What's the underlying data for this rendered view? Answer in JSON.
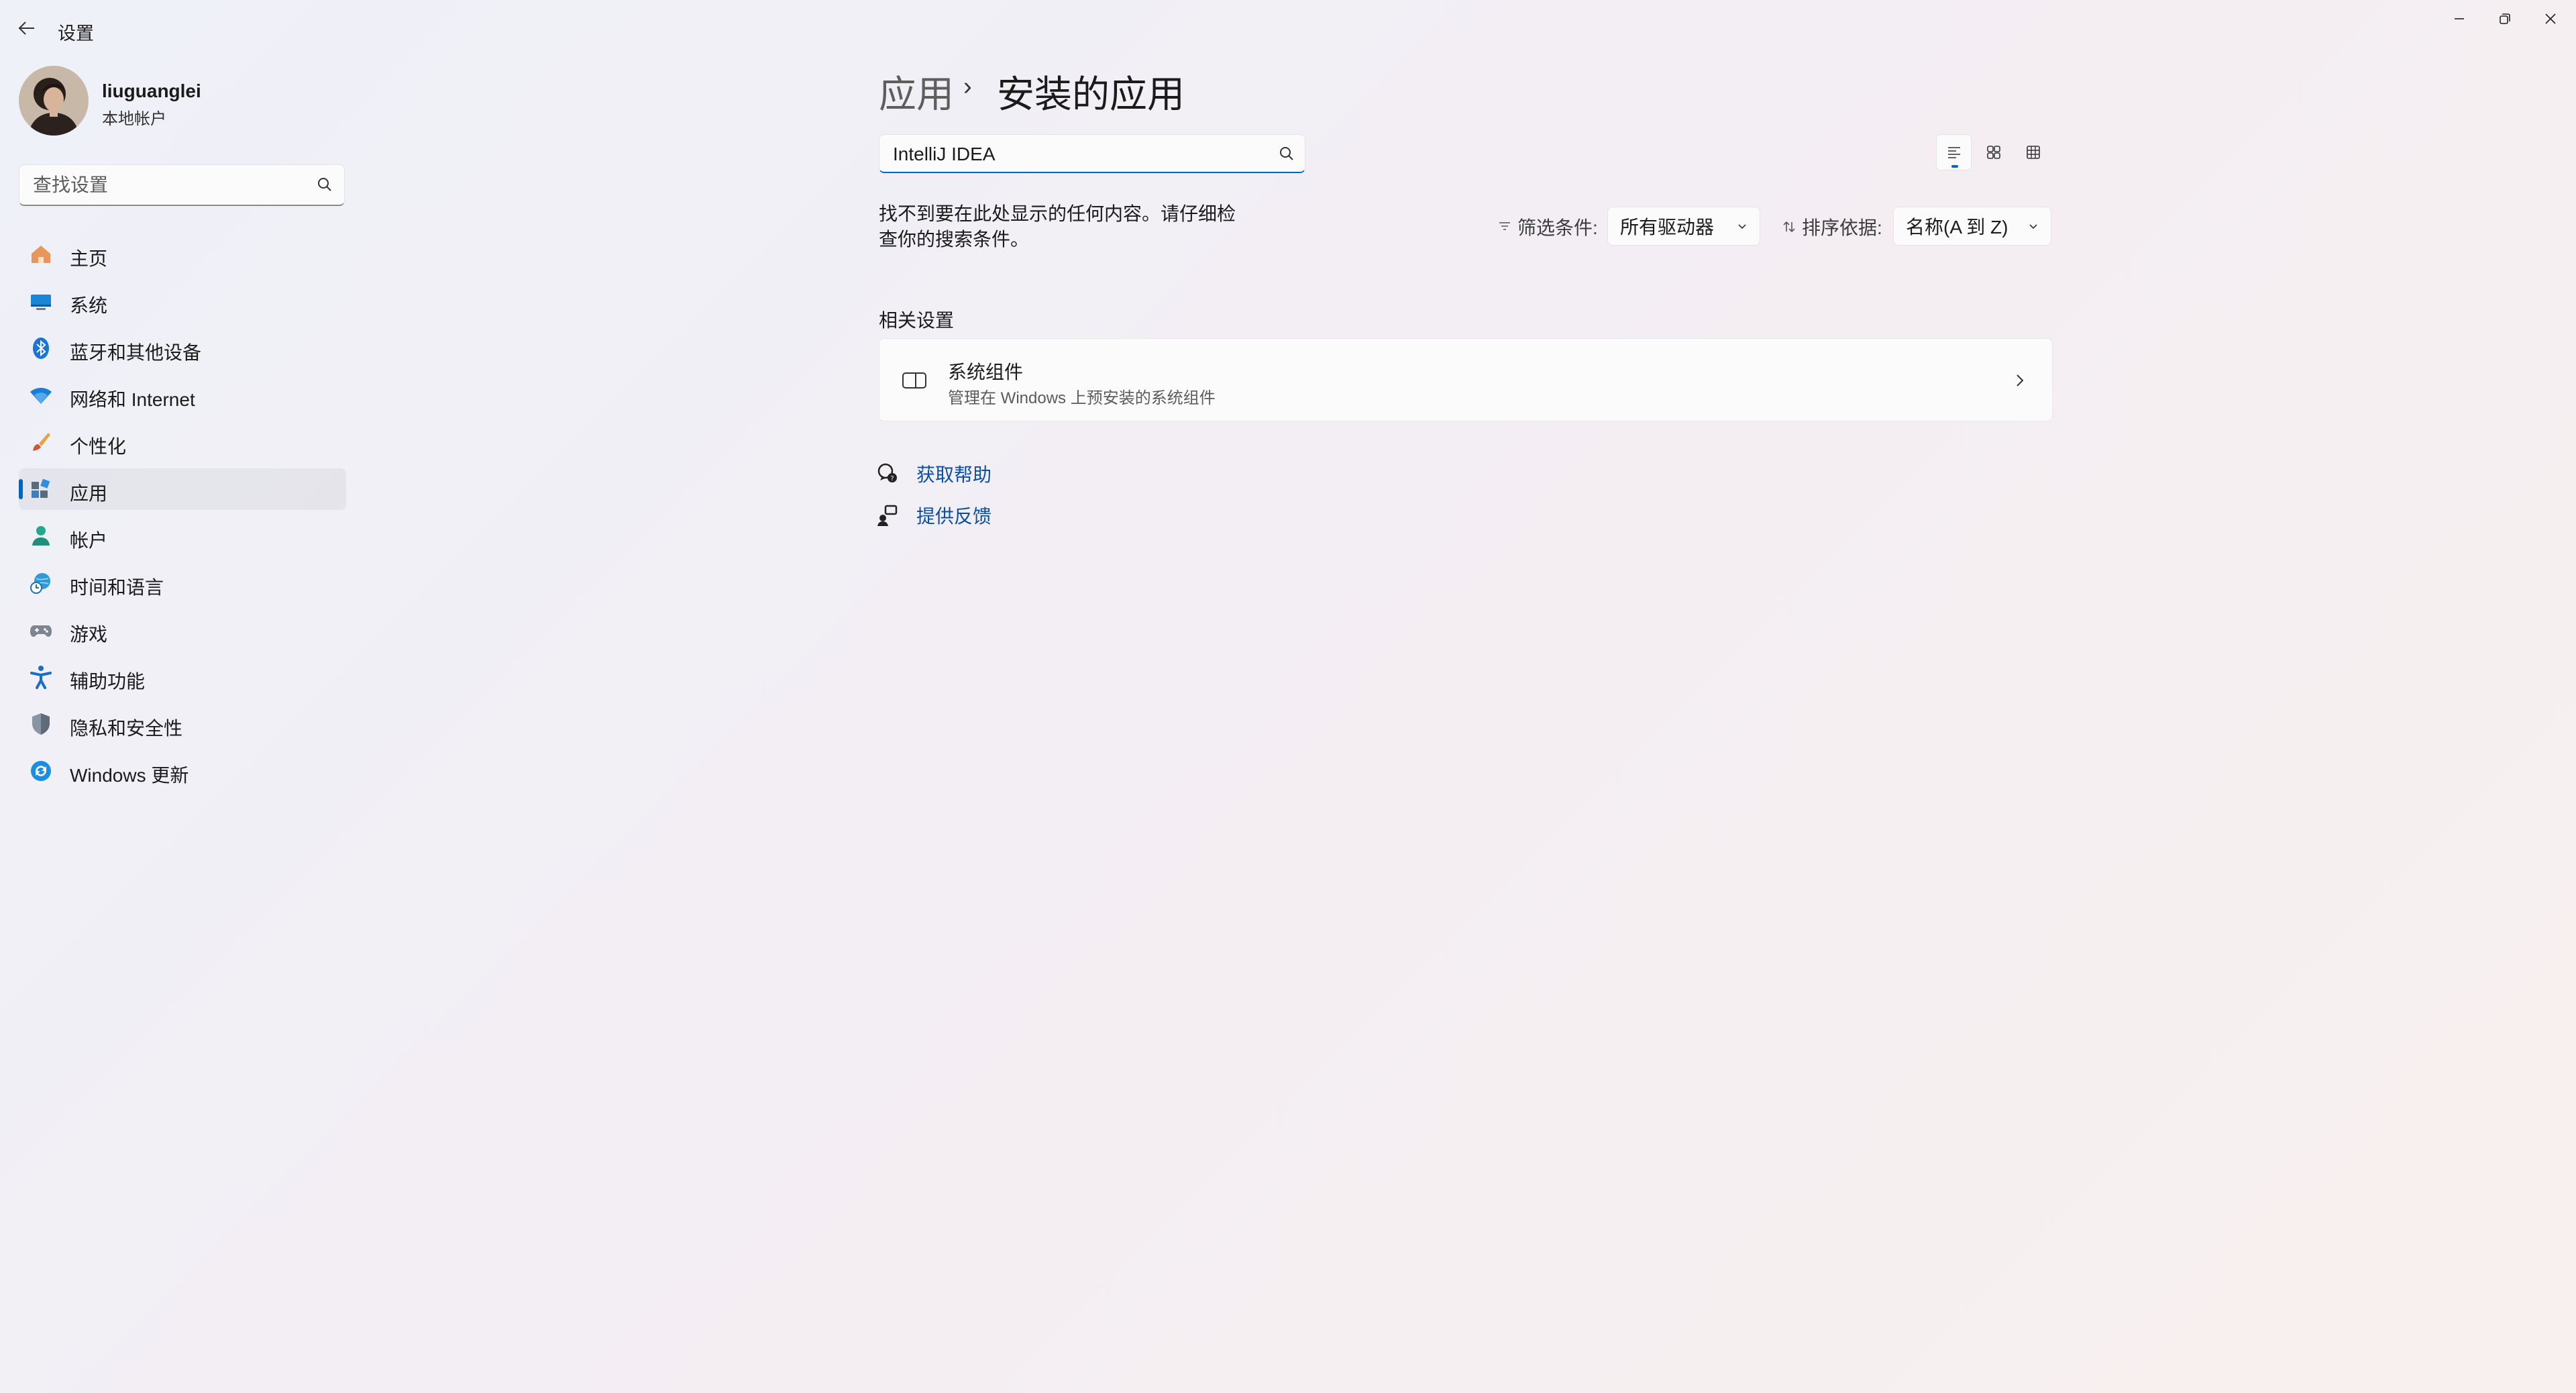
{
  "window": {
    "title": "设置",
    "back_icon": "arrow-left-icon",
    "controls": [
      "minimize-icon",
      "restore-icon",
      "close-icon"
    ]
  },
  "profile": {
    "name": "liuguanglei",
    "account_type": "本地帐户"
  },
  "sidebar": {
    "search_placeholder": "查找设置",
    "items": [
      {
        "label": "主页",
        "icon": "home-icon"
      },
      {
        "label": "系统",
        "icon": "display-icon"
      },
      {
        "label": "蓝牙和其他设备",
        "icon": "bluetooth-icon"
      },
      {
        "label": "网络和 Internet",
        "icon": "wifi-icon"
      },
      {
        "label": "个性化",
        "icon": "paintbrush-icon"
      },
      {
        "label": "应用",
        "icon": "apps-icon",
        "selected": true
      },
      {
        "label": "帐户",
        "icon": "person-icon"
      },
      {
        "label": "时间和语言",
        "icon": "globe-clock-icon"
      },
      {
        "label": "游戏",
        "icon": "gamepad-icon"
      },
      {
        "label": "辅助功能",
        "icon": "accessibility-icon"
      },
      {
        "label": "隐私和安全性",
        "icon": "shield-icon"
      },
      {
        "label": "Windows 更新",
        "icon": "sync-icon"
      }
    ]
  },
  "main": {
    "breadcrumb": {
      "parent": "应用",
      "separator": "›",
      "current": "安装的应用"
    },
    "search_value": "IntelliJ IDEA",
    "view_modes": [
      "list-view-icon",
      "tile-view-icon",
      "grid-view-icon"
    ],
    "no_results": "找不到要在此处显示的任何内容。请仔细检查你的搜索条件。",
    "filter": {
      "label": "筛选条件:",
      "value": "所有驱动器"
    },
    "sort": {
      "label": "排序依据:",
      "value": "名称(A 到 Z)"
    },
    "related_title": "相关设置",
    "related_card": {
      "title": "系统组件",
      "subtitle": "管理在 Windows 上预安装的系统组件"
    },
    "links": {
      "help": "获取帮助",
      "feedback": "提供反馈"
    }
  },
  "colors": {
    "accent": "#0067c0",
    "link": "#0a4fa0"
  }
}
